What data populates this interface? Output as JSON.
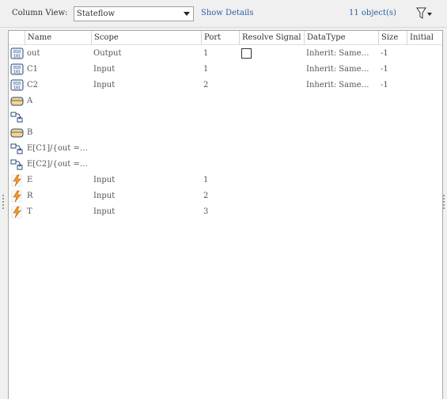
{
  "toolbar": {
    "column_view_label": "Column View:",
    "column_view_value": "Stateflow",
    "show_details": "Show Details",
    "object_count": "11 object(s)"
  },
  "columns": [
    "Name",
    "Scope",
    "Port",
    "Resolve Signal",
    "DataType",
    "Size",
    "Initial"
  ],
  "rows": [
    {
      "icon": "data-icon",
      "name": "out",
      "scope": "Output",
      "port": "1",
      "resolve": true,
      "datatype": "Inherit: Same…",
      "size": "-1"
    },
    {
      "icon": "data-icon",
      "name": "C1",
      "scope": "Input",
      "port": "1",
      "resolve": false,
      "datatype": "Inherit: Same…",
      "size": "-1"
    },
    {
      "icon": "data-icon",
      "name": "C2",
      "scope": "Input",
      "port": "2",
      "resolve": false,
      "datatype": "Inherit: Same…",
      "size": "-1"
    },
    {
      "icon": "state-icon",
      "name": "A",
      "scope": "",
      "port": "",
      "resolve": false,
      "datatype": "",
      "size": ""
    },
    {
      "icon": "transition-icon",
      "name": "",
      "scope": "",
      "port": "",
      "resolve": false,
      "datatype": "",
      "size": ""
    },
    {
      "icon": "state-icon",
      "name": "B",
      "scope": "",
      "port": "",
      "resolve": false,
      "datatype": "",
      "size": ""
    },
    {
      "icon": "transition-icon",
      "name": "E[C1]/{out =…",
      "scope": "",
      "port": "",
      "resolve": false,
      "datatype": "",
      "size": ""
    },
    {
      "icon": "transition-icon",
      "name": "E[C2]/{out =…",
      "scope": "",
      "port": "",
      "resolve": false,
      "datatype": "",
      "size": ""
    },
    {
      "icon": "event-icon",
      "name": "E",
      "scope": "Input",
      "port": "1",
      "resolve": false,
      "datatype": "",
      "size": ""
    },
    {
      "icon": "event-icon",
      "name": "R",
      "scope": "Input",
      "port": "2",
      "resolve": false,
      "datatype": "",
      "size": ""
    },
    {
      "icon": "event-icon",
      "name": "T",
      "scope": "Input",
      "port": "3",
      "resolve": false,
      "datatype": "",
      "size": ""
    }
  ],
  "colors": {
    "link": "#2e5ea8",
    "event_bolt": "#f0a020",
    "state_fill": "#f5d58a",
    "icon_border": "#2c4a78"
  }
}
